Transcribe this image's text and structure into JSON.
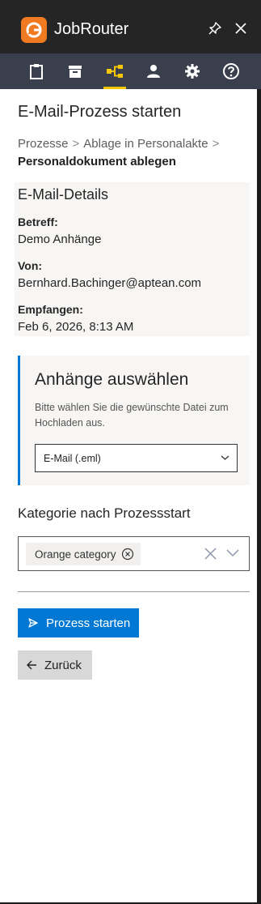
{
  "app": {
    "title": "JobRouter",
    "logo_icon": "jobrouter-logo-icon",
    "colors": {
      "logo": "#f07a22",
      "accent": "#0078d4",
      "nav_active": "#f6c700",
      "nav_bg": "#3a3f4e"
    }
  },
  "titlebar": {
    "pin_icon": "pin-icon",
    "close_icon": "close-icon"
  },
  "nav": {
    "items": [
      {
        "icon": "clipboard-icon",
        "active": false
      },
      {
        "icon": "archive-box-icon",
        "active": false
      },
      {
        "icon": "workflow-icon",
        "active": true
      },
      {
        "icon": "user-icon",
        "active": false
      },
      {
        "icon": "gear-icon",
        "active": false
      },
      {
        "icon": "help-icon",
        "active": false
      }
    ]
  },
  "page": {
    "title": "E-Mail-Prozess starten",
    "breadcrumb": {
      "items": [
        "Prozesse",
        "Ablage in Personalakte"
      ],
      "separator": ">",
      "current": "Personaldokument ablegen"
    }
  },
  "details": {
    "title": "E-Mail-Details",
    "subject_label": "Betreff:",
    "subject_value": "Demo Anhänge",
    "from_label": "Von:",
    "from_value": "Bernhard.Bachinger@aptean.com",
    "received_label": "Empfangen:",
    "received_value": "Feb 6, 2026, 8:13 AM"
  },
  "attachments": {
    "title": "Anhänge auswählen",
    "description": "Bitte wählen Sie die gewünschte Datei zum Hochladen aus.",
    "selected": "E-Mail (.eml)"
  },
  "category": {
    "title": "Kategorie nach Prozessstart",
    "selected_chip": "Orange category"
  },
  "actions": {
    "start_label": "Prozess starten",
    "back_label": "Zurück"
  }
}
